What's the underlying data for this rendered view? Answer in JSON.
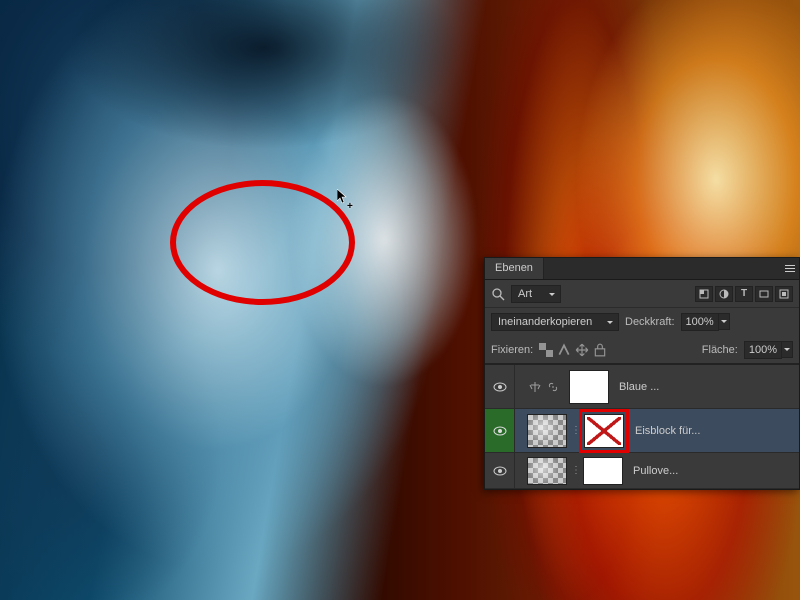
{
  "annotation": {
    "shape": "ellipse",
    "color": "#e00000"
  },
  "panel": {
    "tab_label": "Ebenen",
    "filter_kind_label": "Art",
    "blend_mode": "Ineinanderkopieren",
    "opacity_label": "Deckkraft:",
    "opacity_value": "100%",
    "lock_label": "Fixieren:",
    "fill_label": "Fläche:",
    "fill_value": "100%"
  },
  "layers": [
    {
      "name": "Blaue ...",
      "visible": true,
      "selected": false,
      "has_adjust_icons": true,
      "thumb": "white"
    },
    {
      "name": "Eisblock für...",
      "visible": true,
      "selected": true,
      "vis_green": true,
      "thumb": "checker",
      "mask_disabled": true,
      "highlight_mask": true
    },
    {
      "name": "Pullove...",
      "visible": true,
      "selected": false,
      "thumb": "checker",
      "mask": true
    }
  ]
}
